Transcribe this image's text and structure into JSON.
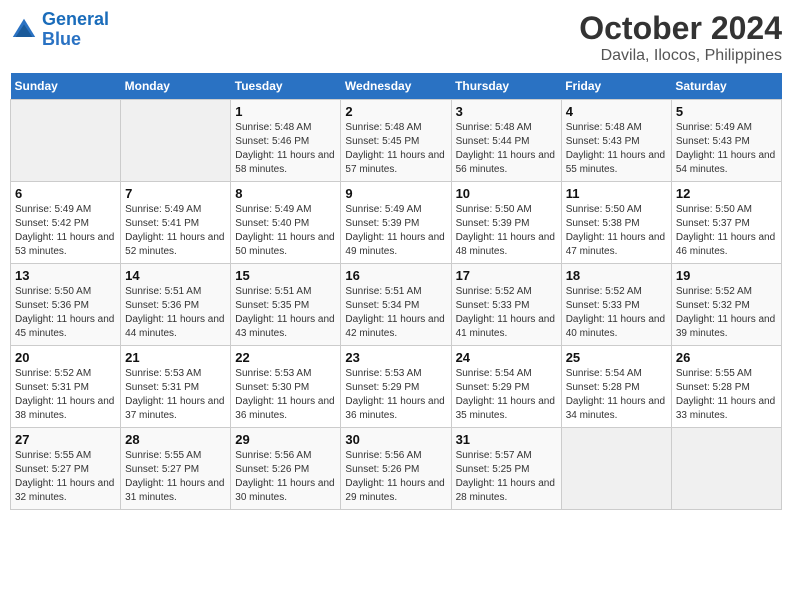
{
  "logo": {
    "line1": "General",
    "line2": "Blue"
  },
  "title": "October 2024",
  "subtitle": "Davila, Ilocos, Philippines",
  "days_of_week": [
    "Sunday",
    "Monday",
    "Tuesday",
    "Wednesday",
    "Thursday",
    "Friday",
    "Saturday"
  ],
  "weeks": [
    [
      {
        "day": "",
        "sunrise": "",
        "sunset": "",
        "daylight": ""
      },
      {
        "day": "",
        "sunrise": "",
        "sunset": "",
        "daylight": ""
      },
      {
        "day": "1",
        "sunrise": "Sunrise: 5:48 AM",
        "sunset": "Sunset: 5:46 PM",
        "daylight": "Daylight: 11 hours and 58 minutes."
      },
      {
        "day": "2",
        "sunrise": "Sunrise: 5:48 AM",
        "sunset": "Sunset: 5:45 PM",
        "daylight": "Daylight: 11 hours and 57 minutes."
      },
      {
        "day": "3",
        "sunrise": "Sunrise: 5:48 AM",
        "sunset": "Sunset: 5:44 PM",
        "daylight": "Daylight: 11 hours and 56 minutes."
      },
      {
        "day": "4",
        "sunrise": "Sunrise: 5:48 AM",
        "sunset": "Sunset: 5:43 PM",
        "daylight": "Daylight: 11 hours and 55 minutes."
      },
      {
        "day": "5",
        "sunrise": "Sunrise: 5:49 AM",
        "sunset": "Sunset: 5:43 PM",
        "daylight": "Daylight: 11 hours and 54 minutes."
      }
    ],
    [
      {
        "day": "6",
        "sunrise": "Sunrise: 5:49 AM",
        "sunset": "Sunset: 5:42 PM",
        "daylight": "Daylight: 11 hours and 53 minutes."
      },
      {
        "day": "7",
        "sunrise": "Sunrise: 5:49 AM",
        "sunset": "Sunset: 5:41 PM",
        "daylight": "Daylight: 11 hours and 52 minutes."
      },
      {
        "day": "8",
        "sunrise": "Sunrise: 5:49 AM",
        "sunset": "Sunset: 5:40 PM",
        "daylight": "Daylight: 11 hours and 50 minutes."
      },
      {
        "day": "9",
        "sunrise": "Sunrise: 5:49 AM",
        "sunset": "Sunset: 5:39 PM",
        "daylight": "Daylight: 11 hours and 49 minutes."
      },
      {
        "day": "10",
        "sunrise": "Sunrise: 5:50 AM",
        "sunset": "Sunset: 5:39 PM",
        "daylight": "Daylight: 11 hours and 48 minutes."
      },
      {
        "day": "11",
        "sunrise": "Sunrise: 5:50 AM",
        "sunset": "Sunset: 5:38 PM",
        "daylight": "Daylight: 11 hours and 47 minutes."
      },
      {
        "day": "12",
        "sunrise": "Sunrise: 5:50 AM",
        "sunset": "Sunset: 5:37 PM",
        "daylight": "Daylight: 11 hours and 46 minutes."
      }
    ],
    [
      {
        "day": "13",
        "sunrise": "Sunrise: 5:50 AM",
        "sunset": "Sunset: 5:36 PM",
        "daylight": "Daylight: 11 hours and 45 minutes."
      },
      {
        "day": "14",
        "sunrise": "Sunrise: 5:51 AM",
        "sunset": "Sunset: 5:36 PM",
        "daylight": "Daylight: 11 hours and 44 minutes."
      },
      {
        "day": "15",
        "sunrise": "Sunrise: 5:51 AM",
        "sunset": "Sunset: 5:35 PM",
        "daylight": "Daylight: 11 hours and 43 minutes."
      },
      {
        "day": "16",
        "sunrise": "Sunrise: 5:51 AM",
        "sunset": "Sunset: 5:34 PM",
        "daylight": "Daylight: 11 hours and 42 minutes."
      },
      {
        "day": "17",
        "sunrise": "Sunrise: 5:52 AM",
        "sunset": "Sunset: 5:33 PM",
        "daylight": "Daylight: 11 hours and 41 minutes."
      },
      {
        "day": "18",
        "sunrise": "Sunrise: 5:52 AM",
        "sunset": "Sunset: 5:33 PM",
        "daylight": "Daylight: 11 hours and 40 minutes."
      },
      {
        "day": "19",
        "sunrise": "Sunrise: 5:52 AM",
        "sunset": "Sunset: 5:32 PM",
        "daylight": "Daylight: 11 hours and 39 minutes."
      }
    ],
    [
      {
        "day": "20",
        "sunrise": "Sunrise: 5:52 AM",
        "sunset": "Sunset: 5:31 PM",
        "daylight": "Daylight: 11 hours and 38 minutes."
      },
      {
        "day": "21",
        "sunrise": "Sunrise: 5:53 AM",
        "sunset": "Sunset: 5:31 PM",
        "daylight": "Daylight: 11 hours and 37 minutes."
      },
      {
        "day": "22",
        "sunrise": "Sunrise: 5:53 AM",
        "sunset": "Sunset: 5:30 PM",
        "daylight": "Daylight: 11 hours and 36 minutes."
      },
      {
        "day": "23",
        "sunrise": "Sunrise: 5:53 AM",
        "sunset": "Sunset: 5:29 PM",
        "daylight": "Daylight: 11 hours and 36 minutes."
      },
      {
        "day": "24",
        "sunrise": "Sunrise: 5:54 AM",
        "sunset": "Sunset: 5:29 PM",
        "daylight": "Daylight: 11 hours and 35 minutes."
      },
      {
        "day": "25",
        "sunrise": "Sunrise: 5:54 AM",
        "sunset": "Sunset: 5:28 PM",
        "daylight": "Daylight: 11 hours and 34 minutes."
      },
      {
        "day": "26",
        "sunrise": "Sunrise: 5:55 AM",
        "sunset": "Sunset: 5:28 PM",
        "daylight": "Daylight: 11 hours and 33 minutes."
      }
    ],
    [
      {
        "day": "27",
        "sunrise": "Sunrise: 5:55 AM",
        "sunset": "Sunset: 5:27 PM",
        "daylight": "Daylight: 11 hours and 32 minutes."
      },
      {
        "day": "28",
        "sunrise": "Sunrise: 5:55 AM",
        "sunset": "Sunset: 5:27 PM",
        "daylight": "Daylight: 11 hours and 31 minutes."
      },
      {
        "day": "29",
        "sunrise": "Sunrise: 5:56 AM",
        "sunset": "Sunset: 5:26 PM",
        "daylight": "Daylight: 11 hours and 30 minutes."
      },
      {
        "day": "30",
        "sunrise": "Sunrise: 5:56 AM",
        "sunset": "Sunset: 5:26 PM",
        "daylight": "Daylight: 11 hours and 29 minutes."
      },
      {
        "day": "31",
        "sunrise": "Sunrise: 5:57 AM",
        "sunset": "Sunset: 5:25 PM",
        "daylight": "Daylight: 11 hours and 28 minutes."
      },
      {
        "day": "",
        "sunrise": "",
        "sunset": "",
        "daylight": ""
      },
      {
        "day": "",
        "sunrise": "",
        "sunset": "",
        "daylight": ""
      }
    ]
  ]
}
